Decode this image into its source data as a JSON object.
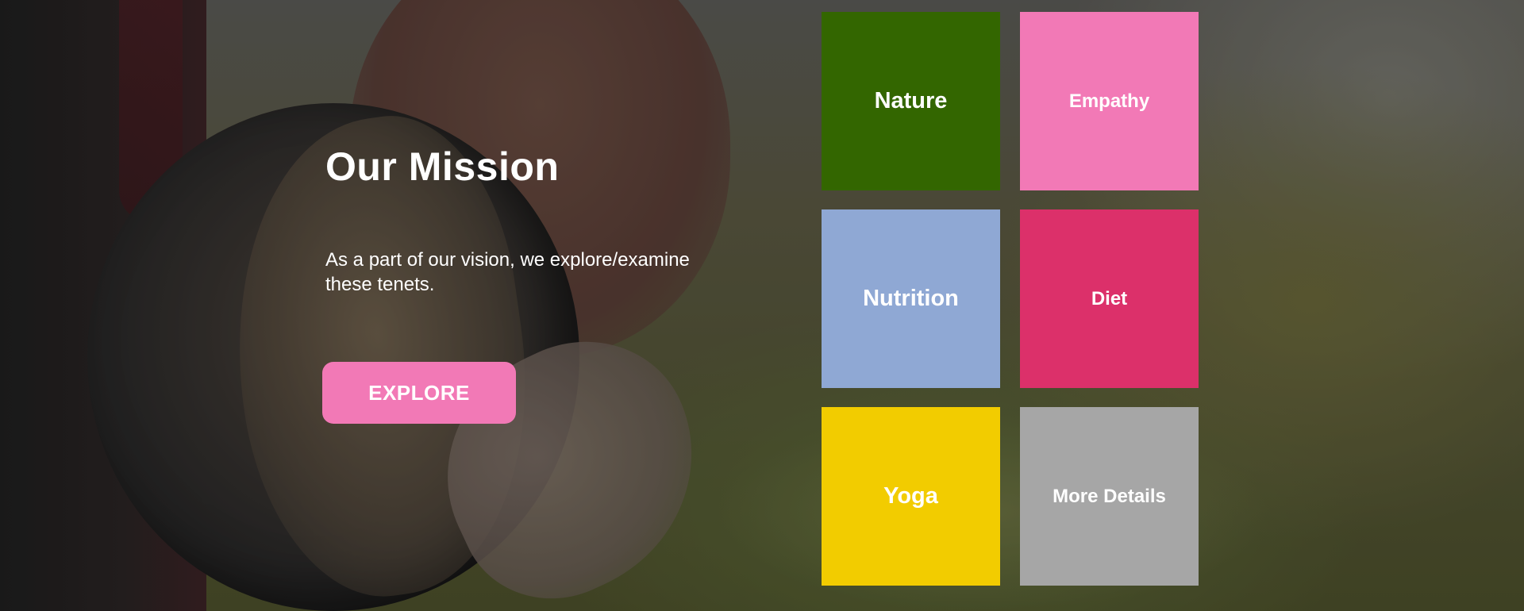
{
  "mission": {
    "title": "Our Mission",
    "description": "As a part of our vision, we explore/examine these tenets.",
    "button_label": "EXPLORE",
    "button_color": "#f279b6"
  },
  "tiles": [
    {
      "label": "Nature",
      "color": "#336600"
    },
    {
      "label": "Empathy",
      "color": "#f279b6"
    },
    {
      "label": "Nutrition",
      "color": "#8fa8d4"
    },
    {
      "label": "Diet",
      "color": "#dc306a"
    },
    {
      "label": "Yoga",
      "color": "#f2cc00"
    },
    {
      "label": "More Details",
      "color": "#a6a6a6"
    }
  ]
}
